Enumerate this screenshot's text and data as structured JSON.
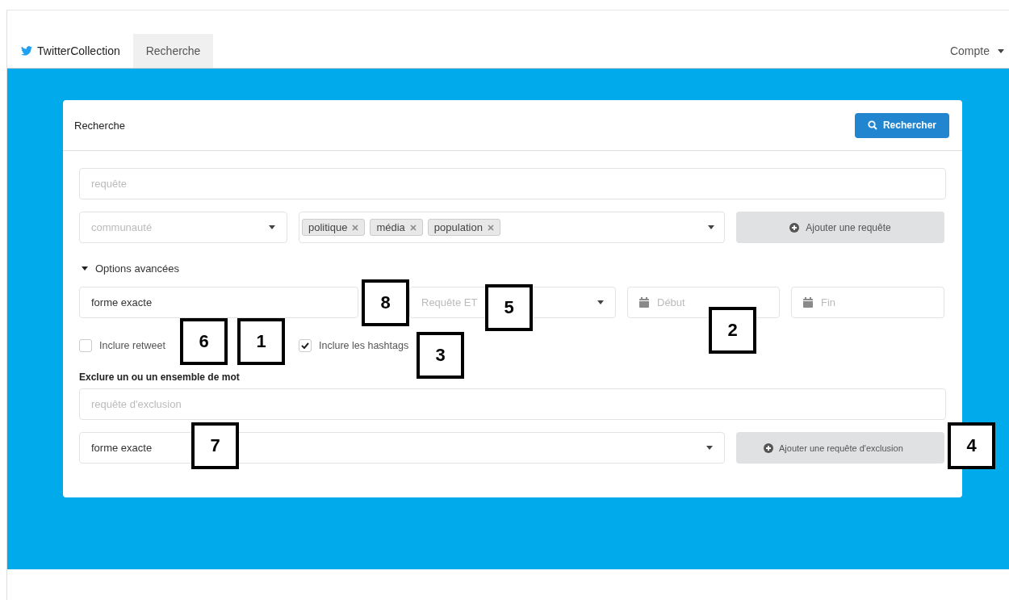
{
  "navbar": {
    "brand": "TwitterCollection",
    "tabs": [
      {
        "label": "Recherche",
        "selected": true
      }
    ],
    "account": "Compte"
  },
  "card": {
    "title": "Recherche",
    "search_button": "Rechercher"
  },
  "query": {
    "placeholder": "requête"
  },
  "community": {
    "placeholder": "communauté"
  },
  "tags": [
    "politique",
    "média",
    "population"
  ],
  "add_query_button": "Ajouter une requête",
  "advanced": {
    "label": "Options avancées",
    "expanded": true,
    "match_mode": "forme exacte",
    "operator": {
      "placeholder": "Requête ET"
    },
    "start": {
      "placeholder": "Début"
    },
    "end": {
      "placeholder": "Fin"
    },
    "checkboxes": [
      {
        "label": "Inclure retweet",
        "checked": false
      },
      {
        "label": "Inclure les hashtags",
        "checked": true
      }
    ]
  },
  "exclude": {
    "heading": "Exclure un ou un ensemble de mot",
    "placeholder": "requête d'exclusion",
    "match_mode": "forme exacte",
    "add_button": "Ajouter une requête d'exclusion"
  },
  "callouts": [
    "8",
    "5",
    "6",
    "1",
    "3",
    "2",
    "7",
    "4"
  ]
}
